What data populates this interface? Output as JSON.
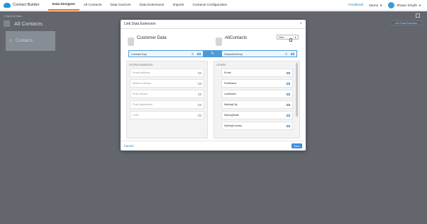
{
  "brand": {
    "name": "Contact Builder"
  },
  "nav": {
    "tabs": [
      {
        "label": "Data Designer",
        "active": true
      },
      {
        "label": "All Contacts",
        "active": false
      },
      {
        "label": "Data Sources",
        "active": false
      },
      {
        "label": "Data Extensions",
        "active": false
      },
      {
        "label": "Imports",
        "active": false
      },
      {
        "label": "Contacts Configuration",
        "active": false
      }
    ],
    "feedback": "Feedback",
    "account": "Demo",
    "user": "Shane Smyth"
  },
  "background": {
    "back_link": "< Back to Data...",
    "title": "All Contacts",
    "card_label": "Contacts",
    "button": "Link Data Extension"
  },
  "modal": {
    "title": "Link Data Extension",
    "left_title": "Customer Data",
    "right_title": "AllContacts",
    "relationship": "One",
    "left_key": "Contact Key",
    "right_key": "SubscriberKey",
    "left_section": "SYSTEM GENERATED",
    "right_section": "OTHERS",
    "left_fields": [
      "Email Address",
      "Mobile Address",
      "Push Device",
      "Push Application",
      "LINE"
    ],
    "right_fields": [
      "Email",
      "FirstName",
      "LastName",
      "MailingCity",
      "MailingState",
      "MailingCountry"
    ],
    "cancel": "Cancel",
    "save": "Save"
  },
  "colors": {
    "accent": "#4e9ad6",
    "active_tab": "#f26b1d",
    "link": "#1a7fc4",
    "save_button": "#3e8ddd"
  }
}
